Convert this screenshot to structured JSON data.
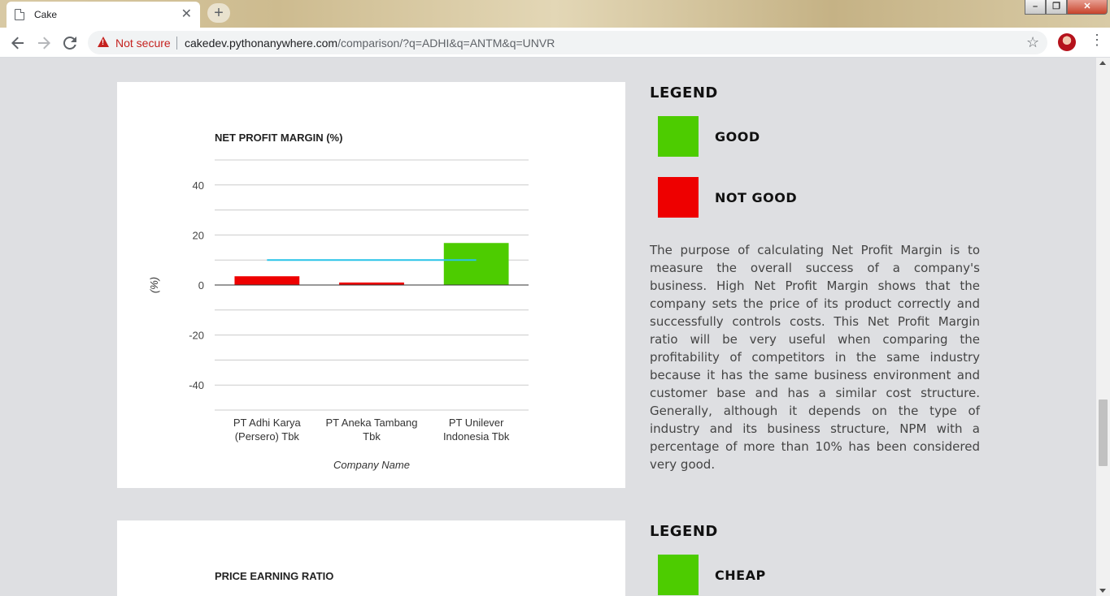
{
  "browser": {
    "tab_title": "Cake",
    "tab_close": "✕",
    "new_tab": "+",
    "security_label": "Not secure",
    "url_host": "cakedev.pythonanywhere.com",
    "url_path": "/comparison/?q=ADHI&q=ANTM&q=UNVR",
    "window_controls": {
      "minimize": "–",
      "maximize": "❐",
      "close": "✕"
    }
  },
  "colors": {
    "good": "#4dcc00",
    "not_good": "#ee0000",
    "threshold_line": "#29c4e8"
  },
  "sections": [
    {
      "legend_heading": "LEGEND",
      "legend_items": [
        {
          "label": "GOOD",
          "color": "#4dcc00"
        },
        {
          "label": "NOT GOOD",
          "color": "#ee0000"
        }
      ],
      "description": "The purpose of calculating Net Profit Margin is to measure the overall success of a company's business. High Net Profit Margin shows that the company sets the price of its product correctly and successfully controls costs. This Net Profit Margin ratio will be very useful when comparing the profitability of competitors in the same industry because it has the same business environment and customer base and has a similar cost structure. Generally, although it depends on the type of industry and its business structure, NPM with a percentage of more than 10% has been considered very good."
    },
    {
      "legend_heading": "LEGEND",
      "legend_items": [
        {
          "label": "CHEAP",
          "color": "#4dcc00"
        }
      ]
    }
  ],
  "chart_data": [
    {
      "type": "bar",
      "title": "NET PROFIT MARGIN (%)",
      "xlabel": "Company Name",
      "ylabel": "(%)",
      "categories": [
        "PT Adhi Karya (Persero) Tbk",
        "PT Aneka Tambang Tbk",
        "PT Unilever Indonesia Tbk"
      ],
      "category_lines": [
        [
          "PT Adhi Karya",
          "(Persero) Tbk"
        ],
        [
          "PT Aneka Tambang",
          "Tbk"
        ],
        [
          "PT Unilever",
          "Indonesia Tbk"
        ]
      ],
      "values": [
        3.5,
        1.0,
        16.8
      ],
      "bar_colors": [
        "#ee0000",
        "#ee0000",
        "#4dcc00"
      ],
      "threshold": 10,
      "ylim": [
        -50,
        50
      ],
      "yticks": [
        -40,
        -20,
        0,
        20,
        40
      ],
      "grid": true,
      "legend": "none"
    },
    {
      "type": "bar",
      "title": "PRICE EARNING RATIO"
    }
  ]
}
